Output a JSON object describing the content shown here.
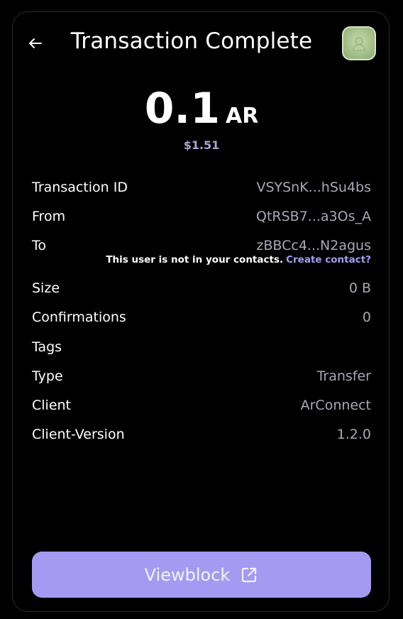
{
  "header": {
    "title": "Transaction Complete"
  },
  "amount": {
    "value": "0.1",
    "unit": "AR",
    "fiat": "$1.51"
  },
  "details": [
    {
      "label": "Transaction ID",
      "value": "VSYSnK...hSu4bs"
    },
    {
      "label": "From",
      "value": "QtRSB7...a3Os_A"
    },
    {
      "label": "To",
      "value": "zBBCc4...N2agus"
    },
    {
      "label": "Size",
      "value": "0 B"
    },
    {
      "label": "Confirmations",
      "value": "0"
    },
    {
      "label": "Tags",
      "value": ""
    },
    {
      "label": "Type",
      "value": "Transfer"
    },
    {
      "label": "Client",
      "value": "ArConnect"
    },
    {
      "label": "Client-Version",
      "value": "1.2.0"
    }
  ],
  "contact_note": {
    "text": "This user is not in your contacts.",
    "link": "Create contact?"
  },
  "button": {
    "label": "Viewblock"
  },
  "colors": {
    "accent": "#a59af2",
    "link": "#a59cf5",
    "fiat": "#a7a6d6",
    "value_text": "#a8a8b8",
    "background": "#000000"
  },
  "icons": {
    "back": "arrow-left-icon",
    "avatar": "user-avatar",
    "external": "external-link-icon"
  }
}
